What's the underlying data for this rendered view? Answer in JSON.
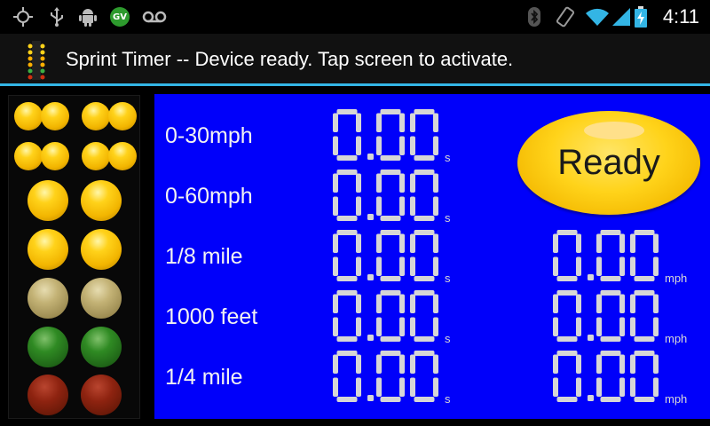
{
  "status_bar": {
    "time": "4:11",
    "left_icons": [
      "gps-icon",
      "usb-icon",
      "android-debug-icon",
      "google-voice-icon",
      "voicemail-icon"
    ],
    "gv_badge_text": "GV",
    "right_icons": [
      "bluetooth-icon",
      "rotation-icon",
      "wifi-icon",
      "signal-icon",
      "battery-charging-icon"
    ]
  },
  "title_bar": {
    "title": "Sprint Timer -- Device ready. Tap screen to activate."
  },
  "light_tree": {
    "lamps": [
      {
        "row": "stage-1",
        "state": "amber"
      },
      {
        "row": "stage-2",
        "state": "amber"
      },
      {
        "row": "amber-1",
        "state": "amber"
      },
      {
        "row": "amber-2",
        "state": "amber"
      },
      {
        "row": "amber-3",
        "state": "dim"
      },
      {
        "row": "green",
        "state": "green"
      },
      {
        "row": "red",
        "state": "red"
      }
    ]
  },
  "timings": {
    "rows": [
      {
        "label": "0-30mph",
        "time": "0.00",
        "time_unit": "s"
      },
      {
        "label": "0-60mph",
        "time": "0.00",
        "time_unit": "s"
      },
      {
        "label": "1/8 mile",
        "time": "0.00",
        "time_unit": "s",
        "speed": "0.00",
        "speed_unit": "mph"
      },
      {
        "label": "1000 feet",
        "time": "0.00",
        "time_unit": "s",
        "speed": "0.00",
        "speed_unit": "mph"
      },
      {
        "label": "1/4 mile",
        "time": "0.00",
        "time_unit": "s",
        "speed": "0.00",
        "speed_unit": "mph"
      }
    ]
  },
  "ready_button": {
    "label": "Ready"
  },
  "colors": {
    "panel_blue": "#0000fa",
    "accent_line": "#33b5e5",
    "segment_gray": "#d6d6d6",
    "ready_yellow": "#ffd31a"
  }
}
